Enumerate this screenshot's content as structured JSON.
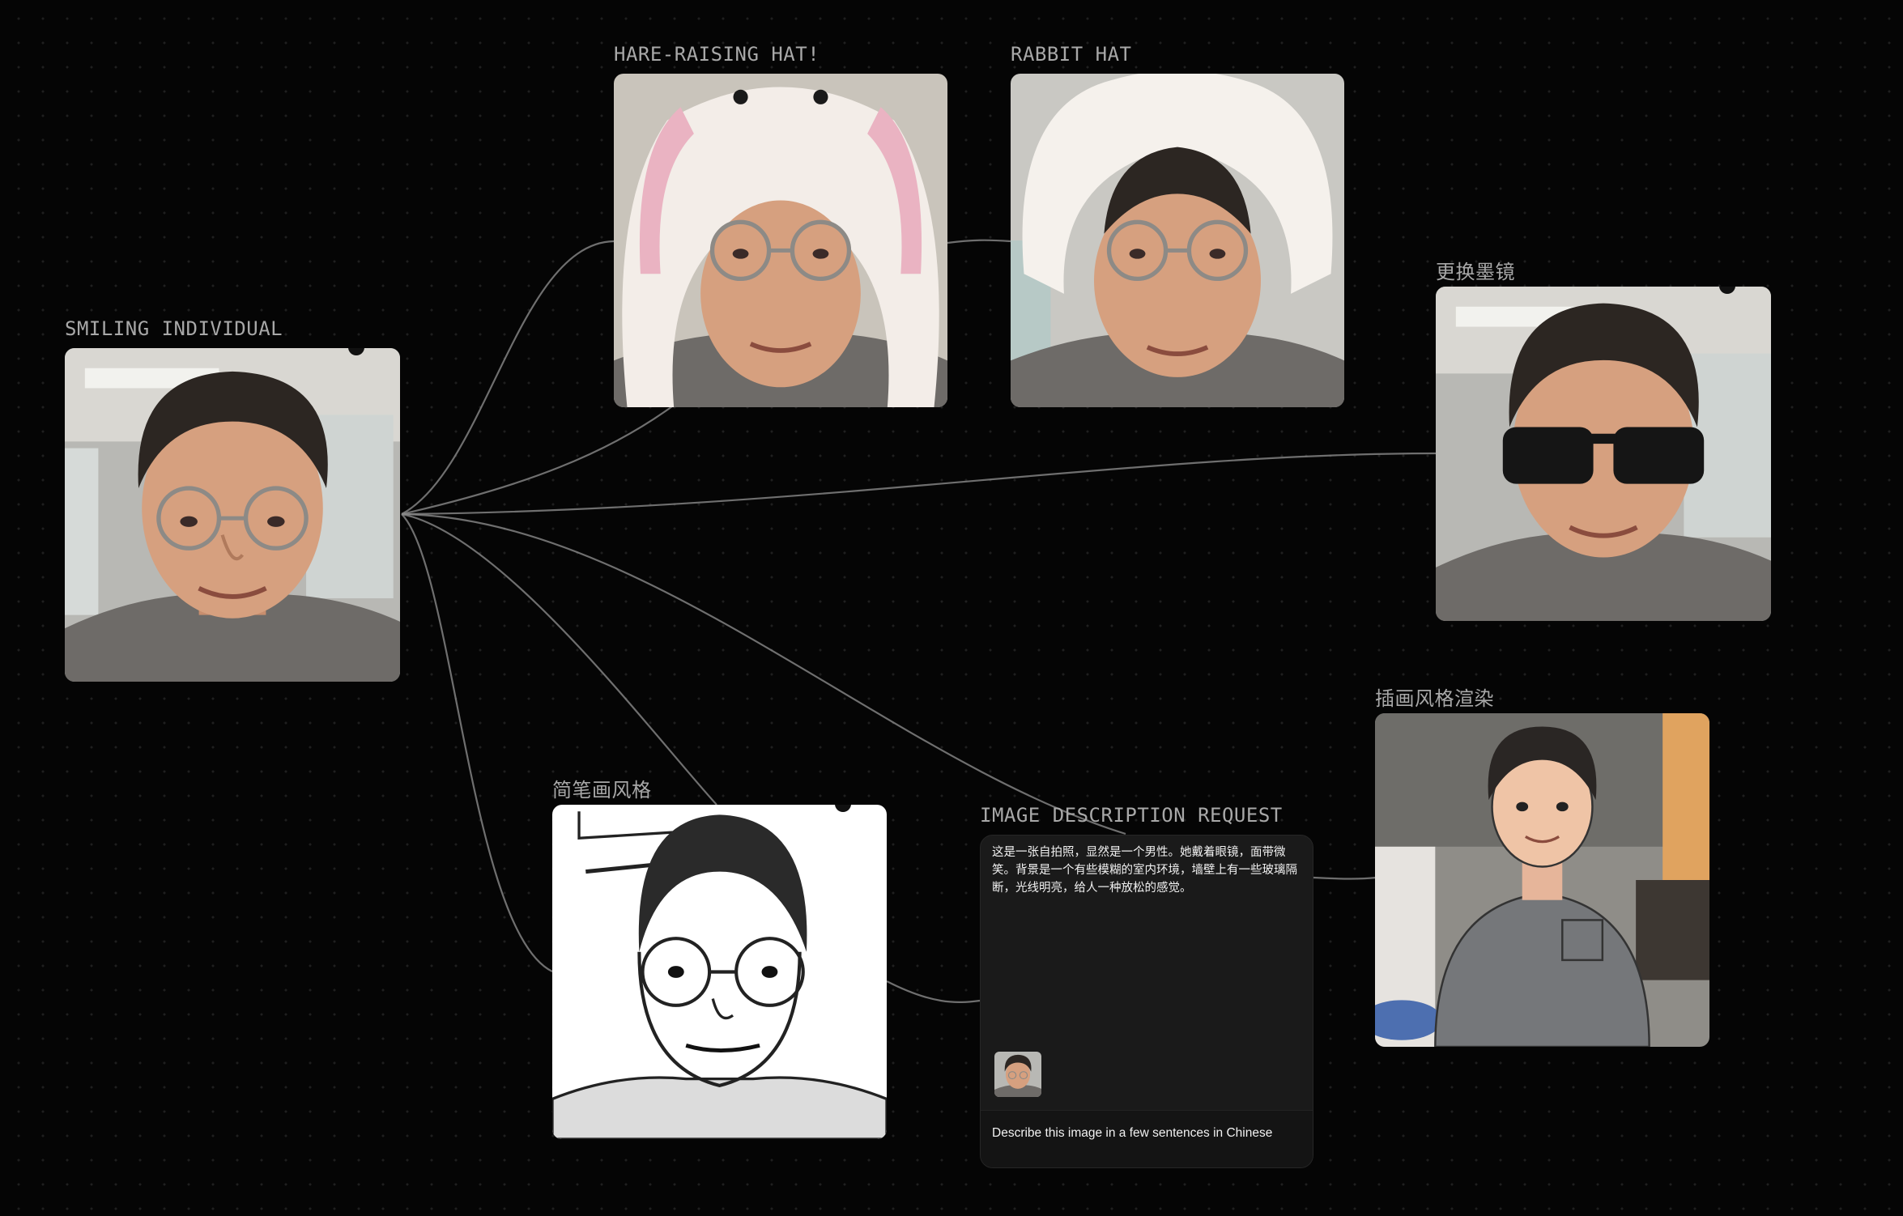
{
  "canvas": {
    "background": "#050505",
    "dot_color": "#1f1f1f",
    "edge_color": "#8a8a8a"
  },
  "nodes": {
    "smiling_individual": {
      "title": "SMILING INDIVIDUAL",
      "content": "selfie photo"
    },
    "hare_raising_hat": {
      "title": "HARE-RAISING HAT!",
      "content": "photo with plush rabbit hat with ears"
    },
    "rabbit_hat": {
      "title": "RABBIT HAT",
      "content": "photo with fluffy white hat"
    },
    "sunglasses": {
      "title": "更换墨镜",
      "content": "photo with black sunglasses"
    },
    "line_drawing": {
      "title": "简笔画风格",
      "content": "black and white line drawing"
    },
    "illustration": {
      "title": "插画风格渲染",
      "content": "cartoon illustration"
    },
    "image_description": {
      "title": "IMAGE DESCRIPTION REQUEST",
      "response": "这是一张自拍照，显然是一个男性。她戴着眼镜，面带微笑。背景是一个有些模糊的室内环境，墙壁上有一些玻璃隔断，光线明亮，给人一种放松的感觉。",
      "prompt": "Describe this image in a few sentences in Chinese"
    }
  }
}
